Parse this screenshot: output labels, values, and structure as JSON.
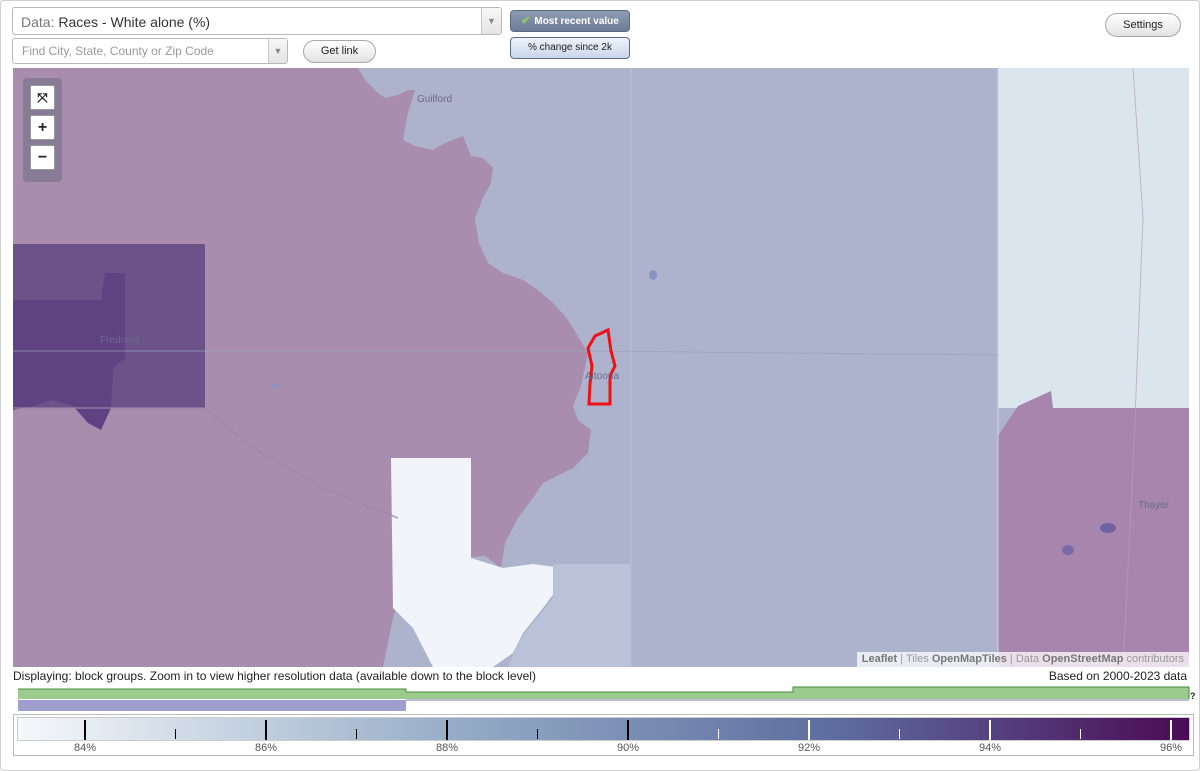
{
  "data_selector": {
    "prefix": "Data:",
    "value": "Races - White alone (%)"
  },
  "search": {
    "placeholder": "Find City, State, County or Zip Code",
    "value": ""
  },
  "buttons": {
    "get_link": "Get link",
    "most_recent": "Most recent value",
    "pct_change": "% change since 2k",
    "settings": "Settings"
  },
  "map": {
    "labels": {
      "guilford": "Guilford",
      "fredonia": "Fredonia",
      "altoona": "Altoona",
      "thayer": "Thayer"
    },
    "zoom": {
      "fit": "⤧",
      "in": "+",
      "out": "−"
    },
    "attribution": {
      "leaflet": "Leaflet",
      "sep1": "|",
      "tiles_label": "Tiles",
      "tiles_link": "OpenMapTiles",
      "sep2": "|",
      "data_label": "Data",
      "osm_link": "OpenStreetMap",
      "contributors": "contributors"
    },
    "colors": {
      "light": "#aeb3cd",
      "mid": "#a88dae",
      "dark": "#6b5289",
      "darker": "#5f4282",
      "near_white": "#f1f4f8",
      "pale_blue": "#dbe5ed",
      "highlight": "#ee1111"
    }
  },
  "info": {
    "displaying": "Displaying: block groups. Zoom in to view higher resolution data (available down to the block level)",
    "based_on": "Based on 2000-2023 data",
    "help": "?"
  },
  "legend": {
    "labels": [
      "84%",
      "86%",
      "88%",
      "90%",
      "92%",
      "94%",
      "96%"
    ],
    "values": [
      84,
      86,
      88,
      90,
      92,
      94,
      96
    ],
    "colors": {
      "start": "#f5f8fb",
      "mid": "#8fa7c3",
      "mid2": "#5d6c9f",
      "end": "#4b0a56"
    }
  },
  "timeline": {
    "colors": {
      "green": "#9bcc8e",
      "green_border": "#4a8a3c",
      "purple": "#9e9fcf"
    }
  }
}
